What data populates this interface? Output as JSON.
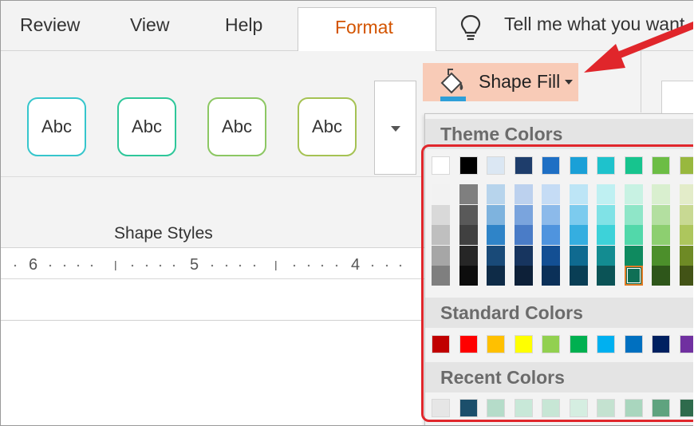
{
  "tabs": {
    "review": "Review",
    "view": "View",
    "help": "Help",
    "format": "Format",
    "tell_me": "Tell me what you want"
  },
  "shape_styles": {
    "sample_label": "Abc",
    "group_label": "Shape Styles",
    "borders": [
      "#36c6cc",
      "#2ec79a",
      "#8cc763",
      "#a5c253"
    ]
  },
  "ruler": {
    "numbers": [
      "6",
      "5",
      "4"
    ]
  },
  "shape_fill": {
    "label": "Shape Fill",
    "accent": "#f8cbb7"
  },
  "palette": {
    "theme_colors_label": "Theme Colors",
    "standard_colors_label": "Standard Colors",
    "recent_colors_label": "Recent Colors",
    "theme_top": [
      "#ffffff",
      "#000000",
      "#dbe7f3",
      "#1e3d6b",
      "#1e6fc4",
      "#1aa0d7",
      "#1ec2cc",
      "#17c48e",
      "#6cbd45",
      "#98b83e"
    ],
    "theme_shades": [
      [
        "#f2f2f2",
        "#d9d9d9",
        "#bfbfbf",
        "#a6a6a6",
        "#7f7f7f"
      ],
      [
        "#7f7f7f",
        "#595959",
        "#404040",
        "#262626",
        "#0d0d0d"
      ],
      [
        "#b7d4ec",
        "#7eb3de",
        "#2f84c8",
        "#194a78",
        "#0e2b47"
      ],
      [
        "#bcd1ee",
        "#7aa4dd",
        "#4a7cc7",
        "#17355f",
        "#0d2038"
      ],
      [
        "#c5dcf5",
        "#8cbaea",
        "#4f94de",
        "#134f93",
        "#0b3058"
      ],
      [
        "#bde5f6",
        "#7ccbee",
        "#35aee0",
        "#0f6a90",
        "#093e55"
      ],
      [
        "#bff0f2",
        "#80e2e6",
        "#3dd2d9",
        "#138c91",
        "#0b5356"
      ],
      [
        "#c8f2e3",
        "#8fe6c8",
        "#52d8aa",
        "#0f8a5f",
        "#095237"
      ],
      [
        "#d9efcf",
        "#b3dfa0",
        "#8dcf70",
        "#4c8f2b",
        "#2e561a"
      ],
      [
        "#e3ecc9",
        "#c8d993",
        "#adc65d",
        "#6e8a25",
        "#425316"
      ]
    ],
    "selected_color": "#0f6f55",
    "standard": [
      "#c00000",
      "#ff0000",
      "#ffc000",
      "#ffff00",
      "#92d050",
      "#00b050",
      "#00b0f0",
      "#0070c0",
      "#002060",
      "#7030a0"
    ],
    "recent": [
      "#e6e6e6",
      "#1b4f6b",
      "#b5dcc9",
      "#c8e8d8",
      "#c7e6d5",
      "#d5eee1",
      "#c4e2d0",
      "#a9d6be",
      "#5fa37f",
      "#2e6b4c"
    ]
  }
}
